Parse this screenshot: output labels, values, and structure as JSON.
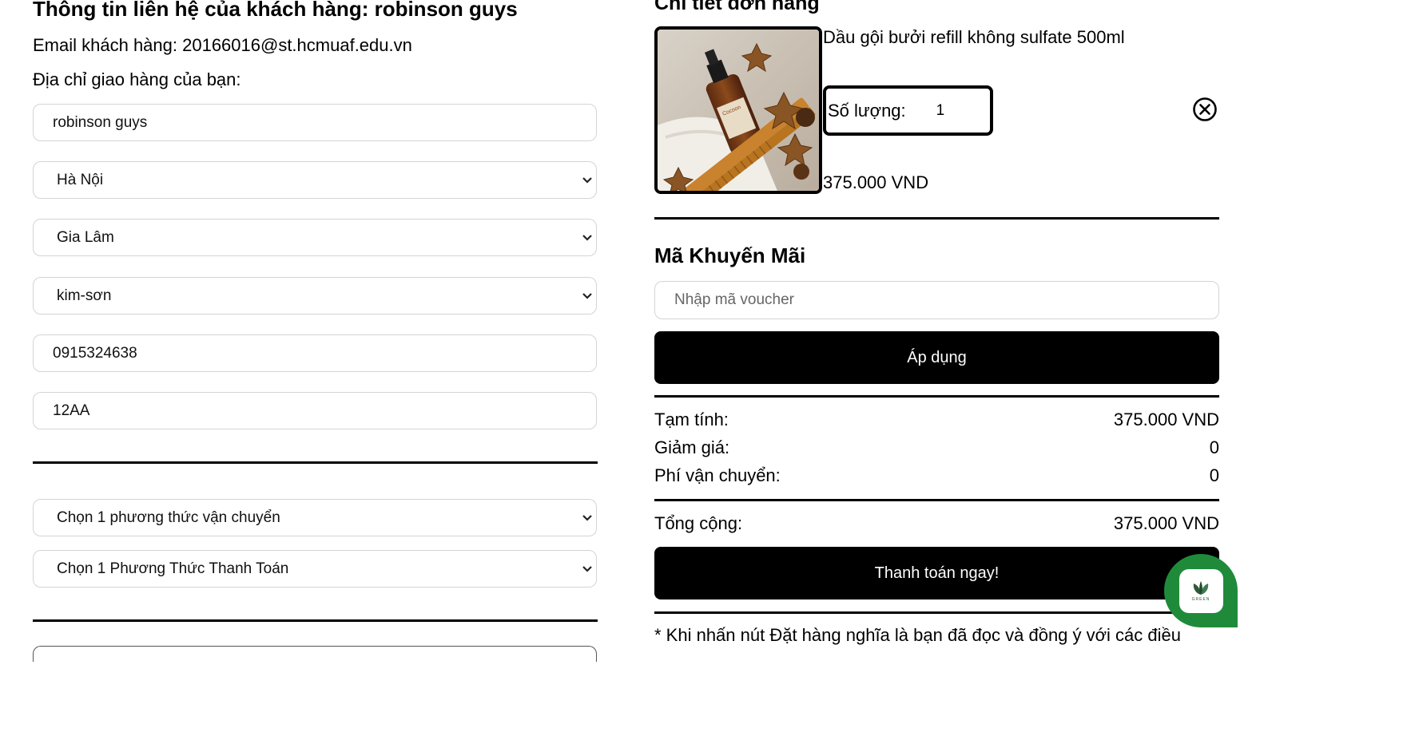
{
  "contact": {
    "title": "Thông tin liên hệ của khách hàng: robinson guys",
    "email_line": "Email khách hàng: 20166016@st.hcmuaf.edu.vn",
    "address_label": "Địa chỉ giao hàng của bạn:",
    "name_value": "robinson guys",
    "province": "Hà Nội",
    "district": "Gia Lâm",
    "ward": "kim-sơn",
    "phone_value": "0915324638",
    "street_value": "12AA",
    "shipping_method": "Chọn 1 phương thức vận chuyển",
    "payment_method": "Chọn 1 Phương Thức Thanh Toán"
  },
  "order": {
    "title": "Chi tiết đơn hàng",
    "product_name": "Dầu gội bưởi refill không sulfate 500ml",
    "quantity_label": "Số lượng:",
    "quantity_value": "1",
    "product_price": "375.000 VND",
    "product_image_text": "Cocoon"
  },
  "promo": {
    "title": "Mã Khuyến Mãi",
    "voucher_placeholder": "Nhập mã voucher",
    "apply_label": "Áp dụng"
  },
  "summary": {
    "subtotal_label": "Tạm tính:",
    "subtotal_value": "375.000 VND",
    "discount_label": "Giảm giá:",
    "discount_value": "0",
    "shipping_label": "Phí vận chuyển:",
    "shipping_value": "0",
    "total_label": "Tổng cộng:",
    "total_value": "375.000 VND",
    "checkout_label": "Thanh toán ngay!",
    "note": "* Khi nhấn nút Đặt hàng nghĩa là bạn đã đọc và đồng ý với các điều"
  },
  "chat": {
    "logo_text": "GREEN",
    "color": "#1f8b3a"
  }
}
